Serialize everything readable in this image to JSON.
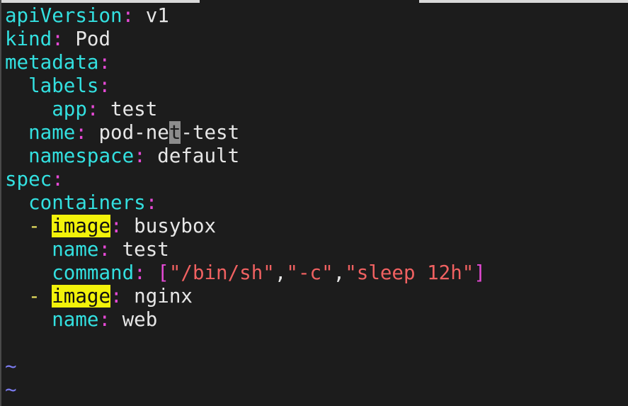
{
  "editor": {
    "lines": [
      {
        "key": "apiVersion",
        "colon": ":",
        "value": " v1"
      },
      {
        "key": "kind",
        "colon": ":",
        "value": " Pod"
      },
      {
        "key": "metadata",
        "colon": ":"
      },
      {
        "indent": "  ",
        "key": "labels",
        "colon": ":"
      },
      {
        "indent": "    ",
        "key": "app",
        "colon": ":",
        "value": " test"
      },
      {
        "indent": "  ",
        "key": "name",
        "colon": ":",
        "value_before_cursor": " pod-ne",
        "cursor_char": "t",
        "value_after_cursor": "-test"
      },
      {
        "indent": "  ",
        "key": "namespace",
        "colon": ":",
        "value": " default"
      },
      {
        "key": "spec",
        "colon": ":"
      },
      {
        "indent": "  ",
        "key": "containers",
        "colon": ":"
      },
      {
        "indent": "  ",
        "dash": "- ",
        "key": "image",
        "colon": ":",
        "value": " busybox"
      },
      {
        "indent": "    ",
        "key": "name",
        "colon": ":",
        "value": " test"
      },
      {
        "indent": "    ",
        "key": "command",
        "colon": ":",
        "space": " ",
        "open": "[",
        "s1": "\"/bin/sh\"",
        "comma1": ",",
        "s2": "\"-c\"",
        "comma2": ",",
        "s3": "\"sleep 12h\"",
        "close": "]"
      },
      {
        "indent": "  ",
        "dash": "- ",
        "key": "image",
        "colon": ":",
        "value": " nginx"
      },
      {
        "indent": "    ",
        "key": "name",
        "colon": ":",
        "value": " web"
      }
    ],
    "tilde_lines": [
      "~",
      "~"
    ]
  },
  "colors": {
    "background": "#1c1c1c",
    "key": "#33e0e0",
    "punctuation": "#e64ad6",
    "string": "#f06161",
    "dash": "#e8e060",
    "search_highlight": "#f2f20a",
    "cursor": "#8c8c8c",
    "tilde": "#7c7cf0"
  }
}
